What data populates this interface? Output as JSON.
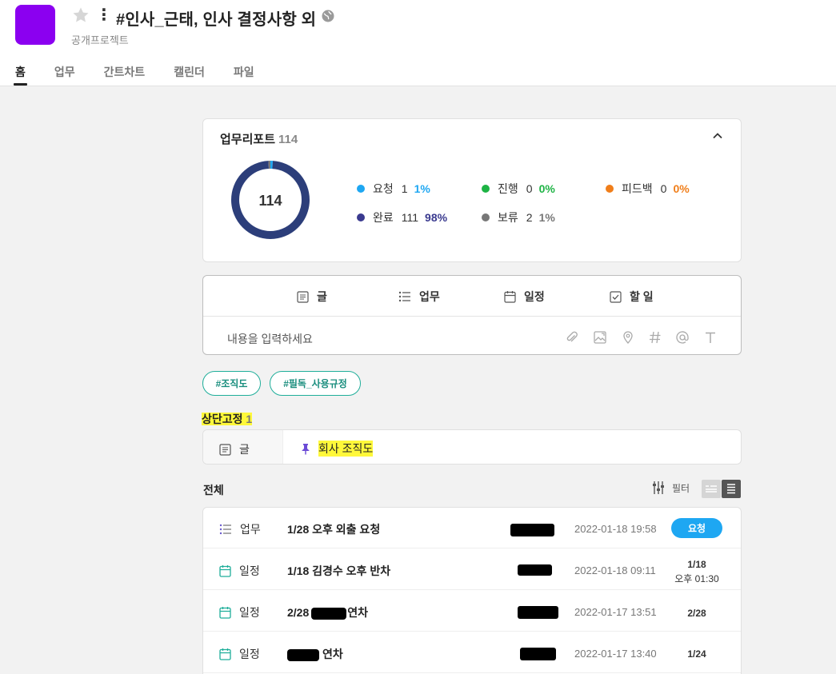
{
  "header": {
    "title": "#인사_근태, 인사 결정사항 외",
    "subtitle": "공개프로젝트",
    "logo_color": "#8b00f0",
    "icons": [
      "star-icon",
      "more-icon",
      "globe-icon"
    ]
  },
  "tabs": [
    {
      "label": "홈",
      "active": true
    },
    {
      "label": "업무",
      "active": false
    },
    {
      "label": "간트차트",
      "active": false
    },
    {
      "label": "캘린더",
      "active": false
    },
    {
      "label": "파일",
      "active": false
    }
  ],
  "report": {
    "title": "업무리포트",
    "count": "114",
    "center": "114",
    "stats": [
      {
        "label": "요청",
        "num": "1",
        "pct": "1%",
        "color": "#1ea7f2",
        "value": 0.01
      },
      {
        "label": "진행",
        "num": "0",
        "pct": "0%",
        "color": "#1db344",
        "value": 0
      },
      {
        "label": "피드백",
        "num": "0",
        "pct": "0%",
        "color": "#f07e1a",
        "value": 0
      },
      {
        "label": "완료",
        "num": "111",
        "pct": "98%",
        "color": "#3a3a8f",
        "value": 0.98
      },
      {
        "label": "보류",
        "num": "2",
        "pct": "1%",
        "color": "#777777",
        "value": 0.01
      }
    ]
  },
  "composer": {
    "tabs": [
      "글",
      "업무",
      "일정",
      "할 일"
    ],
    "placeholder": "내용을 입력하세요",
    "tools": [
      "attach-icon",
      "image-icon",
      "location-icon",
      "hashtag-icon",
      "mention-icon",
      "text-icon"
    ]
  },
  "tags": [
    "#조직도",
    "#필독_사용규정"
  ],
  "pinned": {
    "title": "상단고정",
    "count": "1",
    "items": [
      {
        "type": "글",
        "title": "회사 조직도"
      }
    ]
  },
  "all": {
    "title": "전체",
    "filter_label": "필터",
    "rows": [
      {
        "type": "업무",
        "title": "1/28 오후 외출 요청",
        "date": "2022-01-18 19:58",
        "status": "요청"
      },
      {
        "type": "일정",
        "title": "1/18 김경수 오후 반차",
        "date": "2022-01-18 09:11",
        "due": "1/18",
        "due_time": "오후 01:30"
      },
      {
        "type": "일정",
        "title_before": "2/28",
        "title_after": "연차",
        "date": "2022-01-17 13:51",
        "due": "2/28"
      },
      {
        "type": "일정",
        "title_before": "",
        "title_after": "연차",
        "date": "2022-01-17 13:40",
        "due": "1/24"
      }
    ]
  }
}
